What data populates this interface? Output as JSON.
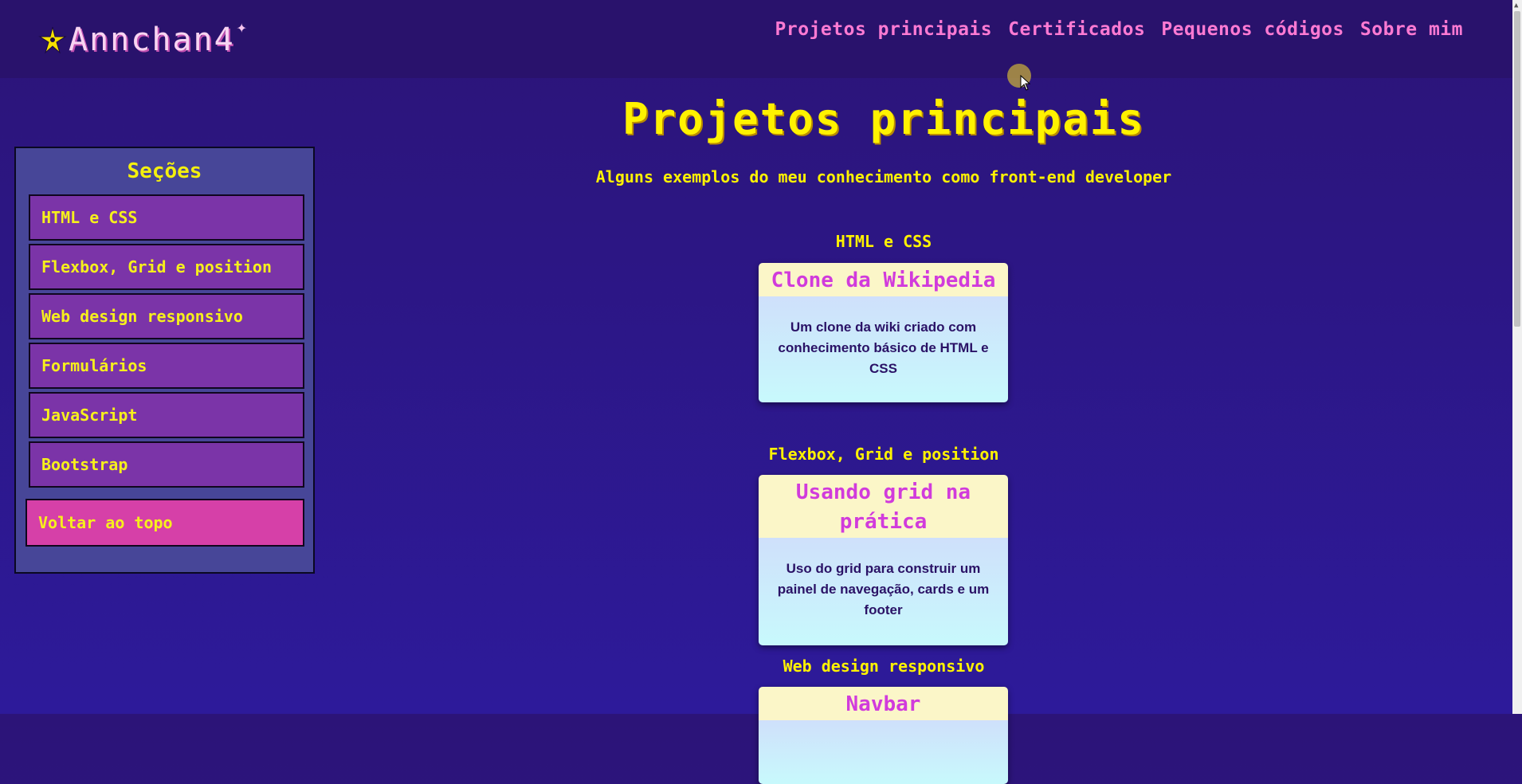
{
  "header": {
    "logo_text": "Annchan",
    "logo_suffix": "4",
    "nav": [
      "Projetos principais",
      "Certificados",
      "Pequenos códigos",
      "Sobre mim"
    ]
  },
  "sidebar": {
    "title": "Seções",
    "items": [
      "HTML e CSS",
      "Flexbox, Grid e position",
      "Web design responsivo",
      "Formulários",
      "JavaScript",
      "Bootstrap"
    ],
    "back_to_top": "Voltar ao topo"
  },
  "main": {
    "title": "Projetos principais",
    "subtitle": "Alguns exemplos do meu conhecimento como front-end developer",
    "sections": [
      {
        "label": "HTML e CSS",
        "card": {
          "title": "Clone da Wikipedia",
          "description": "Um clone da wiki criado com conhecimento básico de HTML e CSS"
        }
      },
      {
        "label": "Flexbox, Grid e position",
        "card": {
          "title": "Usando grid na prática",
          "description": "Uso do grid para construir um painel de navegação, cards e um footer"
        }
      },
      {
        "label": "Web design responsivo",
        "card": {
          "title": "Navbar",
          "description": ""
        }
      }
    ]
  },
  "colors": {
    "background": "#2c1478",
    "nav_link": "#ff7ad3",
    "accent_yellow": "#fff200",
    "card_title": "#d13bdc",
    "sidebar_item": "#7b34a8",
    "back_to_top": "#d640a8"
  },
  "icons": [
    "sparkle-star-icon",
    "logo-sparkle-icon"
  ]
}
